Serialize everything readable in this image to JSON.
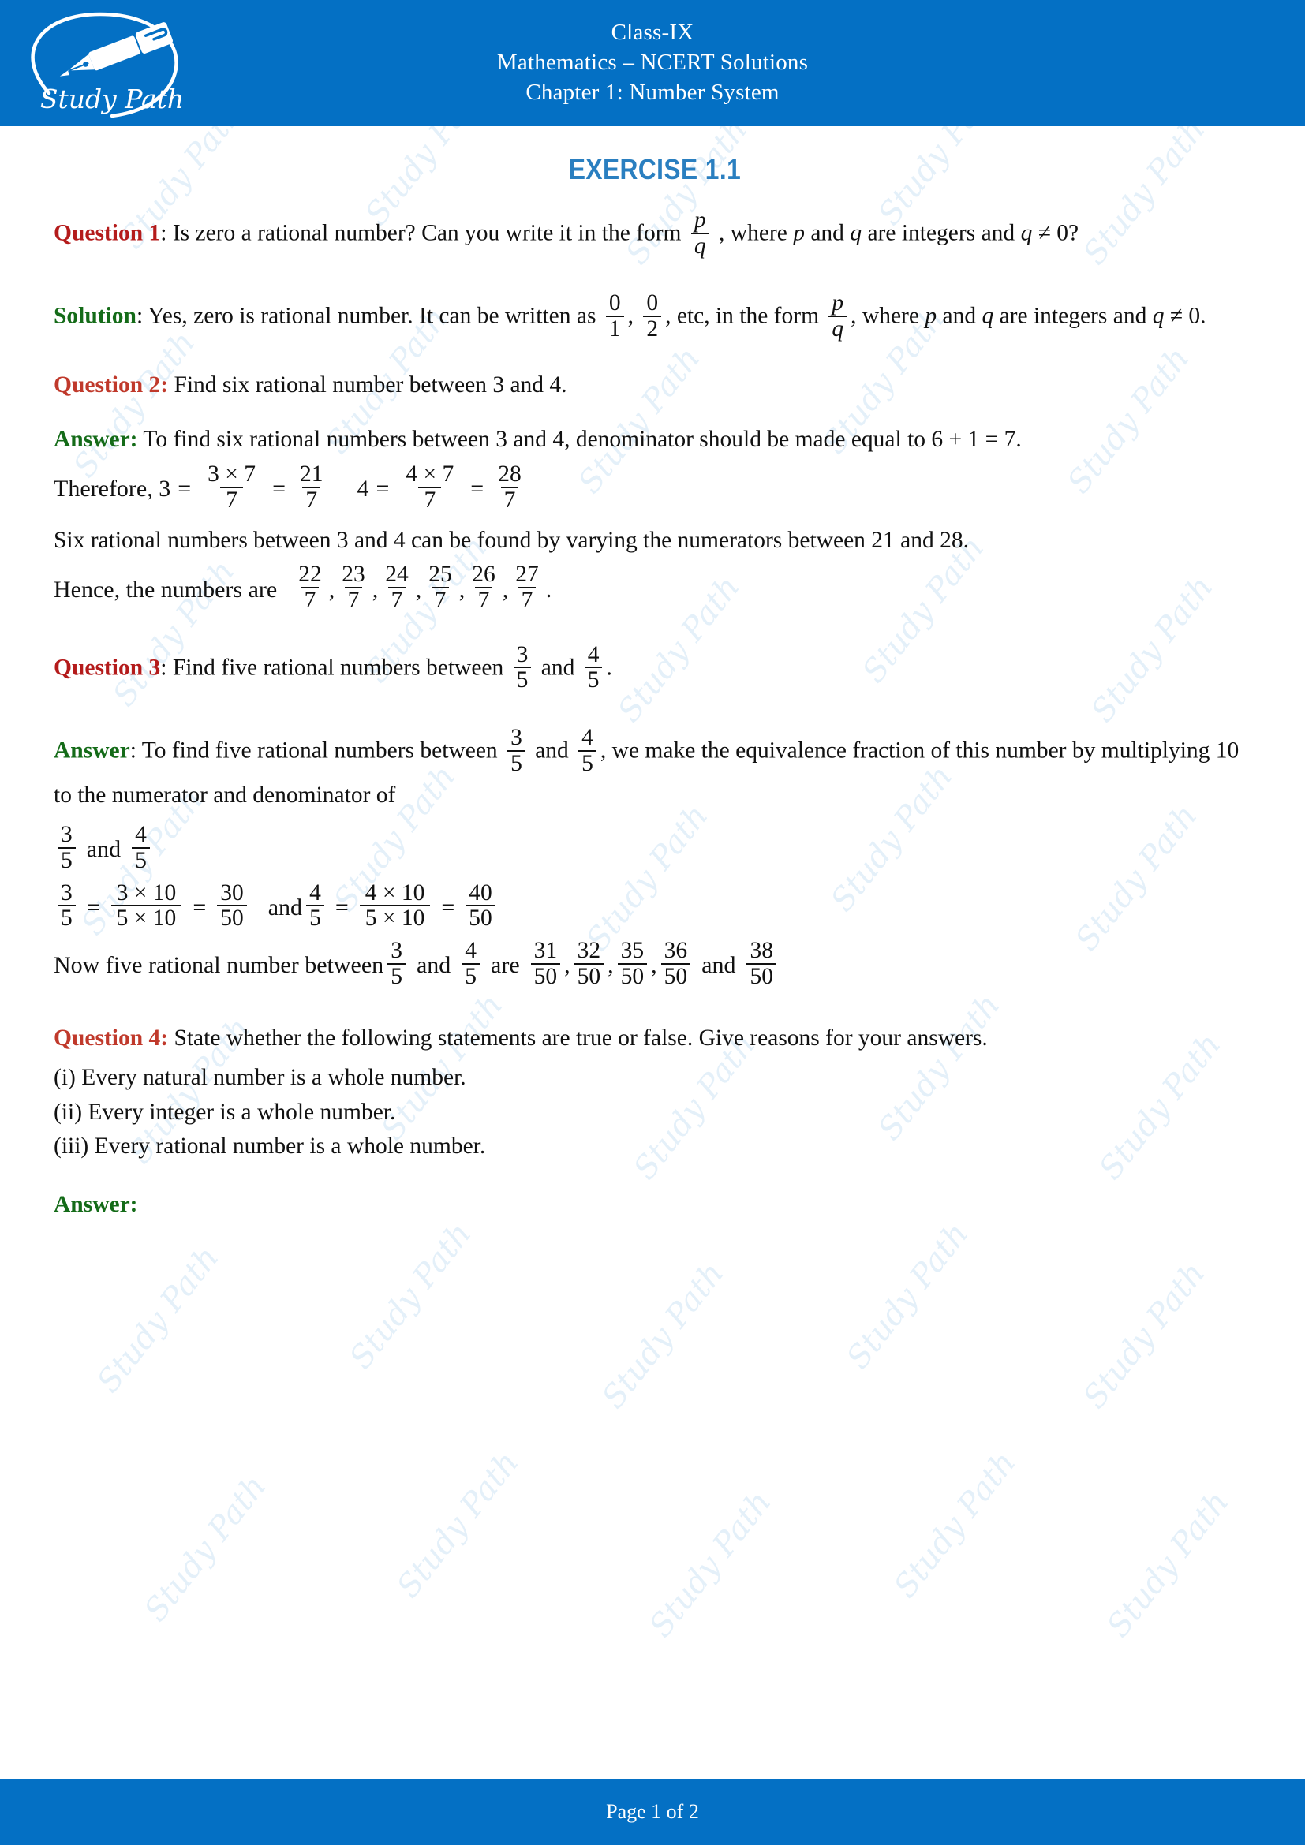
{
  "header": {
    "logo_name": "Study Path",
    "line1": "Class-IX",
    "line2": "Mathematics – NCERT Solutions",
    "line3": "Chapter 1: Number System",
    "bg_color": "#0470c4"
  },
  "exercise_title": "EXERCISE 1.1",
  "colors": {
    "brand_blue": "#0470c4",
    "title_blue": "#2a7fc0",
    "question_red": "#b41b1b",
    "question_red_alt": "#c0392b",
    "answer_green": "#146b18",
    "body_text": "#111111",
    "watermark": "#cfe4f5"
  },
  "watermark_text": "Study Path",
  "q1": {
    "label": "Question 1",
    "sep": ":",
    "text_a": "Is zero a rational number?  Can you write it in the form",
    "frac": {
      "num": "p",
      "den": "q"
    },
    "text_b": ", where",
    "var_p": "p",
    "and": "and",
    "var_q": "q",
    "text_c": "are integers and",
    "cond": "≠ 0?"
  },
  "sol1": {
    "label": "Solution",
    "sep": ":",
    "text_a": "Yes, zero is rational number. It can be written as",
    "frac1": {
      "num": "0",
      "den": "1"
    },
    "comma1": ",",
    "frac2": {
      "num": "0",
      "den": "2"
    },
    "text_b": ", etc, in the form",
    "frac3": {
      "num": "p",
      "den": "q"
    },
    "comma2": ",",
    "text_c": "where",
    "var_p": "p",
    "and": "and",
    "var_q": "q",
    "text_d": "are integers and",
    "cond": "≠ 0."
  },
  "q2": {
    "label": "Question 2:",
    "text": "Find six rational number between 3 and 4."
  },
  "ans2": {
    "label": "Answer:",
    "text_a": "To find six rational numbers between 3 and 4, denominator should be made equal to 6 + 1 = 7.",
    "therefore": "Therefore, 3",
    "eq": "=",
    "f1": {
      "num": "3 × 7",
      "den": "7"
    },
    "f2": {
      "num": "21",
      "den": "7"
    },
    "four": "4",
    "f3": {
      "num": "4 × 7",
      "den": "7"
    },
    "f4": {
      "num": "28",
      "den": "7"
    },
    "text_b": "Six rational numbers between 3 and 4 can be found by varying the numerators between 21 and 28.",
    "hence": "Hence, the numbers are",
    "answers": [
      {
        "num": "22",
        "den": "7"
      },
      {
        "num": "23",
        "den": "7"
      },
      {
        "num": "24",
        "den": "7"
      },
      {
        "num": "25",
        "den": "7"
      },
      {
        "num": "26",
        "den": "7"
      },
      {
        "num": "27",
        "den": "7"
      }
    ],
    "separator": ",",
    "period": "."
  },
  "q3": {
    "label": "Question 3",
    "sep": ":",
    "text_a": "Find five rational numbers between",
    "f1": {
      "num": "3",
      "den": "5"
    },
    "and": "and",
    "f2": {
      "num": "4",
      "den": "5"
    },
    "period": "."
  },
  "ans3": {
    "label": "Answer",
    "sep": ":",
    "text_a": "To find five rational numbers between",
    "f1": {
      "num": "3",
      "den": "5"
    },
    "and": "and",
    "f2": {
      "num": "4",
      "den": "5"
    },
    "text_b": ", we make the equivalence fraction of this number by multiplying 10 to the numerator and denominator of",
    "f3": {
      "num": "3",
      "den": "5"
    },
    "and2": "and",
    "f4": {
      "num": "4",
      "den": "5"
    },
    "eq_f1": {
      "num": "3",
      "den": "5"
    },
    "eq1": "=",
    "eq_f2": {
      "num": "3 × 10",
      "den": "5 × 10"
    },
    "eq2": "=",
    "eq_f3": {
      "num": "30",
      "den": "50"
    },
    "and3": "and",
    "eq_f4": {
      "num": "4",
      "den": "5"
    },
    "eq3": "=",
    "eq_f5": {
      "num": "4 × 10",
      "den": "5 × 10"
    },
    "eq4": "=",
    "eq_f6": {
      "num": "40",
      "den": "50"
    },
    "now_text": "Now five rational number between",
    "now_f1": {
      "num": "3",
      "den": "5"
    },
    "now_and": "and",
    "now_f2": {
      "num": "4",
      "den": "5"
    },
    "are": "are",
    "results": [
      {
        "num": "31",
        "den": "50"
      },
      {
        "num": "32",
        "den": "50"
      },
      {
        "num": "35",
        "den": "50"
      },
      {
        "num": "36",
        "den": "50"
      }
    ],
    "final_and": "and",
    "final": {
      "num": "38",
      "den": "50"
    },
    "separator": ","
  },
  "q4": {
    "label": "Question 4:",
    "text": "State whether the following statements are true or false. Give reasons for your answers.",
    "items": [
      "(i) Every natural number is a whole number.",
      "(ii) Every integer is a whole number.",
      "(iii) Every rational number is a whole number."
    ]
  },
  "ans4": {
    "label": "Answer:"
  },
  "footer": {
    "page_text": "Page 1 of 2"
  }
}
